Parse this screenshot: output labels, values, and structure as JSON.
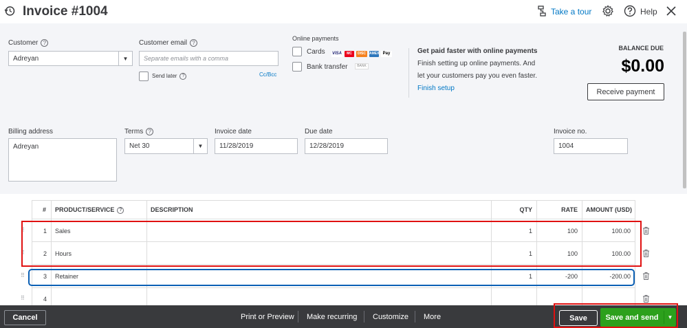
{
  "header": {
    "title": "Invoice #1004",
    "take_tour": "Take a tour",
    "help": "Help"
  },
  "customer": {
    "label": "Customer",
    "value": "Adreyan"
  },
  "customer_email": {
    "label": "Customer email",
    "placeholder": "Separate emails with a comma",
    "send_later": "Send later",
    "cc_bcc": "Cc/Bcc"
  },
  "online_payments": {
    "label": "Online payments",
    "cards": "Cards",
    "bank_transfer": "Bank transfer",
    "card_logos": [
      "VISA",
      "MC",
      "DISC",
      "AMEX",
      "Pay"
    ],
    "bank_logo": "BANK",
    "promo_title": "Get paid faster with online payments",
    "promo_line1": "Finish setting up online payments. And",
    "promo_line2": "let your customers pay you even faster.",
    "finish_setup": "Finish setup"
  },
  "balance": {
    "label": "BALANCE DUE",
    "amount": "$0.00",
    "receive_payment": "Receive payment"
  },
  "billing": {
    "label": "Billing address",
    "value": "Adreyan"
  },
  "terms": {
    "label": "Terms",
    "value": "Net 30"
  },
  "invoice_date": {
    "label": "Invoice date",
    "value": "11/28/2019"
  },
  "due_date": {
    "label": "Due date",
    "value": "12/28/2019"
  },
  "invoice_no": {
    "label": "Invoice no.",
    "value": "1004"
  },
  "table": {
    "headers": {
      "num": "#",
      "product": "PRODUCT/SERVICE",
      "description": "DESCRIPTION",
      "qty": "QTY",
      "rate": "RATE",
      "amount": "AMOUNT (USD)"
    },
    "rows": [
      {
        "num": "1",
        "product": "Sales",
        "description": "",
        "qty": "1",
        "rate": "100",
        "amount": "100.00"
      },
      {
        "num": "2",
        "product": "Hours",
        "description": "",
        "qty": "1",
        "rate": "100",
        "amount": "100.00"
      },
      {
        "num": "3",
        "product": "Retainer",
        "description": "",
        "qty": "1",
        "rate": "-200",
        "amount": "-200.00"
      },
      {
        "num": "4",
        "product": "",
        "description": "",
        "qty": "",
        "rate": "",
        "amount": ""
      }
    ]
  },
  "footer": {
    "cancel": "Cancel",
    "print_preview": "Print or Preview",
    "make_recurring": "Make recurring",
    "customize": "Customize",
    "more": "More",
    "save": "Save",
    "save_and_send": "Save and send"
  },
  "colors": {
    "link": "#0077c5",
    "save_send_green": "#2ca01c",
    "footer_bg": "#393a3d",
    "highlight_red": "#e01010",
    "highlight_blue": "#0a5fb4"
  }
}
